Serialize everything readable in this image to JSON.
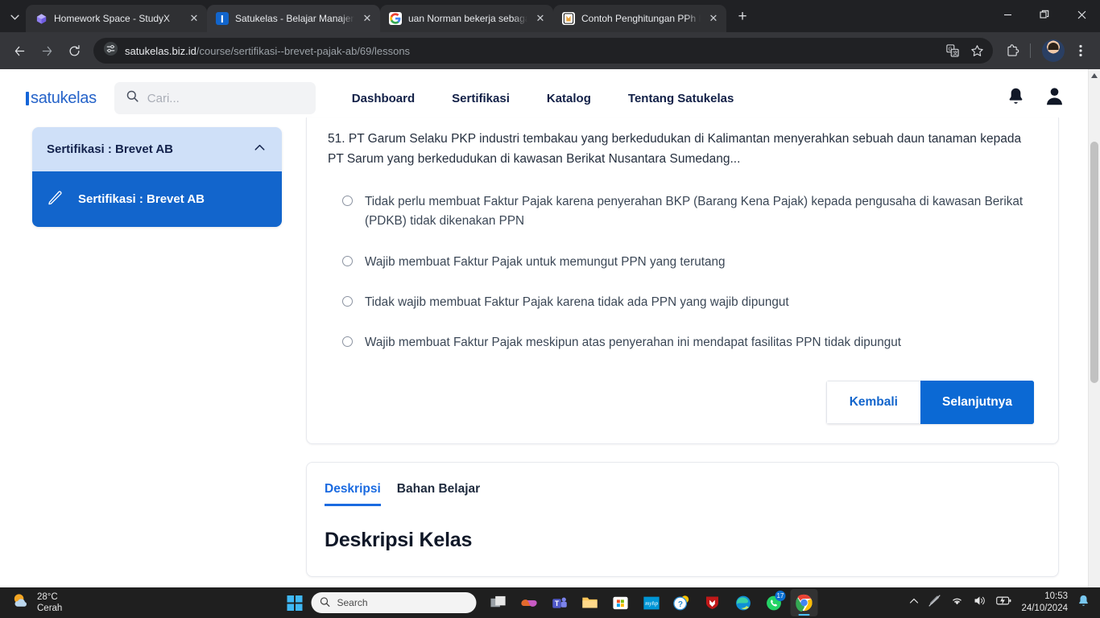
{
  "browser": {
    "tabs": [
      {
        "title": "Homework Space - StudyX",
        "favicon": "studyx-icon",
        "active": false
      },
      {
        "title": "Satukelas - Belajar Manajemen",
        "favicon": "satukelas-icon",
        "active": true
      },
      {
        "title": "uan Norman bekerja sebagai pe",
        "favicon": "google-icon",
        "active": false
      },
      {
        "title": "Contoh Penghitungan PPh Pasa",
        "favicon": "document-icon",
        "active": false
      }
    ],
    "new_tab_label": "+",
    "close_label": "✕",
    "address": {
      "domain": "satukelas.biz.id",
      "path": "/course/sertifikasi--brevet-pajak-ab/69/lessons"
    },
    "window_controls": {
      "minimize": "—",
      "restore": "❐",
      "close": "✕"
    }
  },
  "site": {
    "logo": "satukelas",
    "search": {
      "placeholder": "Cari...",
      "value": ""
    },
    "nav": [
      {
        "label": "Dashboard"
      },
      {
        "label": "Sertifikasi"
      },
      {
        "label": "Katalog"
      },
      {
        "label": "Tentang Satukelas"
      }
    ]
  },
  "sidebar": {
    "section_title": "Sertifikasi : Brevet AB",
    "items": [
      {
        "label": "Sertifikasi : Brevet AB",
        "icon": "pencil-icon",
        "active": true
      }
    ]
  },
  "quiz": {
    "question": "51. PT Garum Selaku PKP industri tembakau yang berkedudukan di Kalimantan menyerahkan sebuah daun tanaman kepada PT Sarum yang berkedudukan di kawasan Berikat Nusantara Sumedang...",
    "options": [
      {
        "label": "Tidak perlu membuat Faktur Pajak karena penyerahan BKP (Barang Kena Pajak) kepada pengusaha di kawasan Berikat (PDKB) tidak dikenakan PPN",
        "selected": false
      },
      {
        "label": "Wajib membuat Faktur Pajak untuk memungut PPN yang terutang",
        "selected": false
      },
      {
        "label": "Tidak wajib membuat Faktur Pajak karena tidak ada PPN yang wajib dipungut",
        "selected": false
      },
      {
        "label": "Wajib membuat Faktur Pajak meskipun atas penyerahan ini mendapat fasilitas PPN tidak dipungut",
        "selected": false
      }
    ],
    "back_label": "Kembali",
    "next_label": "Selanjutnya"
  },
  "description": {
    "tabs": [
      {
        "label": "Deskripsi",
        "active": true
      },
      {
        "label": "Bahan Belajar",
        "active": false
      }
    ],
    "title": "Deskripsi Kelas"
  },
  "taskbar": {
    "weather": {
      "temperature": "28°C",
      "condition": "Cerah"
    },
    "search_placeholder": "Search",
    "apps": [
      {
        "name": "task-view"
      },
      {
        "name": "copilot"
      },
      {
        "name": "teams"
      },
      {
        "name": "file-explorer"
      },
      {
        "name": "microsoft-store"
      },
      {
        "name": "myhp"
      },
      {
        "name": "help"
      },
      {
        "name": "mcafee"
      },
      {
        "name": "edge"
      },
      {
        "name": "whatsapp",
        "badge": "17"
      },
      {
        "name": "chrome",
        "active": true
      }
    ],
    "tray": {
      "time": "10:53",
      "date": "24/10/2024"
    }
  },
  "colors": {
    "brand_blue": "#1265cc",
    "accent_blue": "#1a6ae0",
    "sidebar_head": "#cfe0f8"
  }
}
